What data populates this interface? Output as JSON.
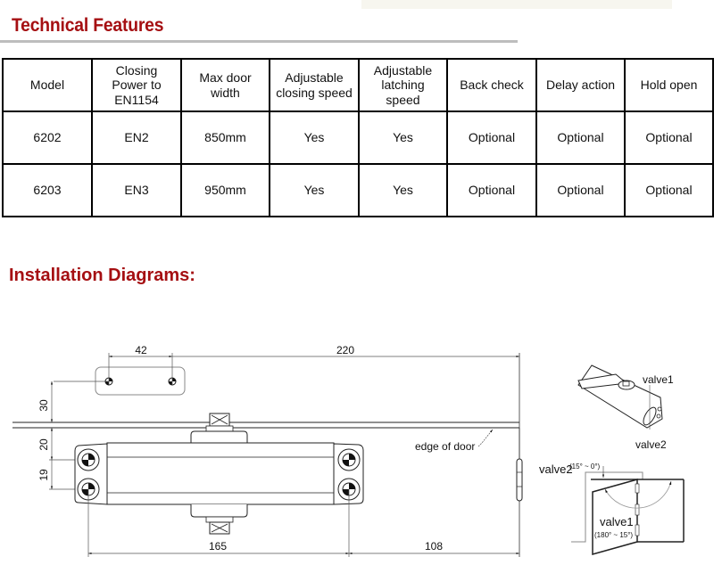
{
  "sections": {
    "technical_features_title": "Technical Features",
    "installation_title": "Installation Diagrams:"
  },
  "colors": {
    "heading": "#a50f12",
    "rule": "#bdbdbd"
  },
  "table": {
    "headers": [
      "Model",
      "Closing Power to EN1154",
      "Max door width",
      "Adjustable closing speed",
      "Adjustable latching speed",
      "Back check",
      "Delay action",
      "Hold open"
    ],
    "rows": [
      [
        "6202",
        "EN2",
        "850mm",
        "Yes",
        "Yes",
        "Optional",
        "Optional",
        "Optional"
      ],
      [
        "6203",
        "EN3",
        "950mm",
        "Yes",
        "Yes",
        "Optional",
        "Optional",
        "Optional"
      ]
    ]
  },
  "diagram": {
    "dimensions": {
      "d42": "42",
      "d220": "220",
      "d30": "30",
      "d20": "20",
      "d19": "19",
      "d165": "165",
      "d108": "108"
    },
    "labels": {
      "edge_of_door": "edge of door",
      "valve1_top": "valve1",
      "valve2_top": "valve2",
      "valve2_door": "valve2",
      "valve2_range": "(15° ~ 0°)",
      "valve1_door": "valve1",
      "valve1_range": "(180° ~ 15°)"
    }
  }
}
